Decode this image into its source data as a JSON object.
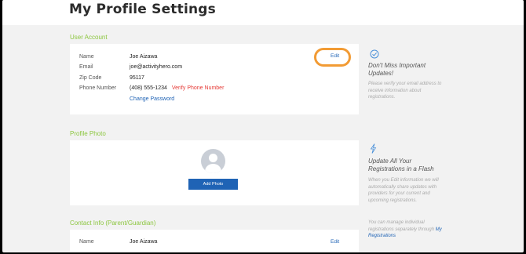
{
  "page": {
    "title": "My Profile Settings"
  },
  "user_account": {
    "section_title": "User Account",
    "edit_label": "Edit",
    "fields": [
      {
        "label": "Name",
        "value": "Joe Aizawa"
      },
      {
        "label": "Email",
        "value": "joe@activityhero.com"
      },
      {
        "label": "Zip Code",
        "value": "95117"
      },
      {
        "label": "Phone Number",
        "value": "(408) 555-1234"
      }
    ],
    "verify_phone_label": "Verify Phone Number",
    "change_password_label": "Change Password"
  },
  "profile_photo": {
    "section_title": "Profile Photo",
    "add_photo_label": "Add Photo"
  },
  "contact_info": {
    "section_title": "Contact Info (Parent/Guardian)",
    "name_label": "Name",
    "name_value": "Joe Aizawa",
    "edit_label": "Edit"
  },
  "sidebar": {
    "tip1": {
      "icon": "check-circle-icon",
      "heading": "Don't Miss Important Updates!",
      "body": "Please verify your email address to receive information about registrations."
    },
    "tip2": {
      "icon": "lightning-icon",
      "heading": "Update All Your Registrations in a Flash",
      "body": "When you Edit information we will automatically share updates with providers for your current and upcoming registrations.",
      "body2": "You can manage individual registrations separately through",
      "link": "My Registrations"
    }
  },
  "colors": {
    "accent": "#8cc63f",
    "link": "#1f63b5",
    "warning": "#e53935",
    "highlight": "#f29b34"
  }
}
